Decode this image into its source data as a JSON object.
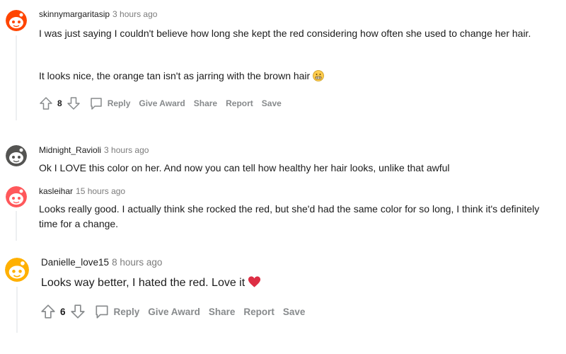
{
  "comments": [
    {
      "username": "skinnymargaritasip",
      "time": "3 hours ago",
      "lines": [
        "I was just saying I couldn't believe how long she kept the red considering how often she used to change her hair.",
        "It looks nice, the orange tan isn't as jarring with the brown hair"
      ],
      "emoji": "grimacing-face-emoji",
      "score": "8",
      "actions": {
        "reply": "Reply",
        "award": "Give Award",
        "share": "Share",
        "report": "Report",
        "save": "Save"
      },
      "avatar_color": "#ff4500"
    },
    {
      "username": "Midnight_Ravioli",
      "time": "3 hours ago",
      "lines": [
        "Ok I LOVE this color on her. And now you can tell how healthy her hair looks, unlike that awful"
      ],
      "avatar_color": "#545452"
    },
    {
      "username": "kasleihar",
      "time": "15 hours ago",
      "lines": [
        "Looks really good. I actually think she rocked the red, but she'd had the same color for so long, I think it's definitely time for a change."
      ],
      "avatar_color": "#ff585b"
    },
    {
      "username": "Danielle_love15",
      "time": "8 hours ago",
      "lines": [
        "Looks way better, I hated the red. Love it"
      ],
      "emoji": "red-heart-emoji",
      "score": "6",
      "actions": {
        "reply": "Reply",
        "award": "Give Award",
        "share": "Share",
        "report": "Report",
        "save": "Save"
      },
      "avatar_color": "#ffb000"
    }
  ],
  "colors": {
    "meta_gray": "#7c7c7c",
    "action_gray": "#878a8c",
    "thread_line": "#edeff1"
  }
}
